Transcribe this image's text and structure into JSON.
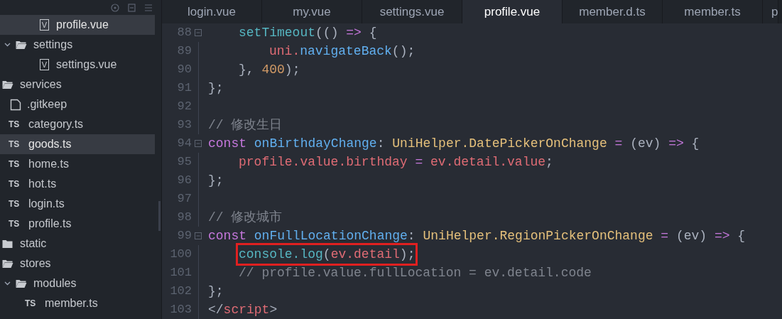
{
  "sidebar": {
    "tree": [
      {
        "kind": "offscreen",
        "children": [
          {
            "kind": "offscreen",
            "children": [
              {
                "kind": "file",
                "label": "profile.vue",
                "badge": "V",
                "selected": true
              }
            ]
          },
          {
            "kind": "folder",
            "label": "settings",
            "expanded": true,
            "selected": false,
            "children": [
              {
                "kind": "file",
                "label": "settings.vue",
                "badge": "V",
                "selected": false
              }
            ]
          }
        ]
      },
      {
        "kind": "folder",
        "label": "services",
        "expanded": true,
        "selected": false,
        "children": [
          {
            "kind": "file",
            "label": ".gitkeep",
            "selected": false
          },
          {
            "kind": "file",
            "label": "category.ts",
            "badge": "TS",
            "selected": false
          },
          {
            "kind": "file",
            "label": "goods.ts",
            "badge": "TS",
            "selected": true
          },
          {
            "kind": "file",
            "label": "home.ts",
            "badge": "TS",
            "selected": false
          },
          {
            "kind": "file",
            "label": "hot.ts",
            "badge": "TS",
            "selected": false
          },
          {
            "kind": "file",
            "label": "login.ts",
            "badge": "TS",
            "selected": false
          },
          {
            "kind": "file",
            "label": "profile.ts",
            "badge": "TS",
            "selected": false
          }
        ]
      },
      {
        "kind": "folder",
        "label": "static",
        "expanded": false,
        "selected": false
      },
      {
        "kind": "folder",
        "label": "stores",
        "expanded": true,
        "selected": false,
        "children": [
          {
            "kind": "folder",
            "label": "modules",
            "expanded": true,
            "selected": false,
            "children": [
              {
                "kind": "file",
                "label": "member.ts",
                "badge": "TS",
                "selected": false
              }
            ]
          }
        ]
      }
    ]
  },
  "tabs": [
    {
      "label": "login.vue",
      "selected": false
    },
    {
      "label": "my.vue",
      "selected": false
    },
    {
      "label": "settings.vue",
      "selected": false
    },
    {
      "label": "profile.vue",
      "selected": true
    },
    {
      "label": "member.d.ts",
      "selected": false
    },
    {
      "label": "member.ts",
      "selected": false
    },
    {
      "label": "p",
      "selected": false
    }
  ],
  "editor": {
    "lines": [
      {
        "kind": "offscreen",
        "children": [
          {
            "kind": "line",
            "number": "88",
            "foldable": true,
            "tokens": [
              {
                "kind": "func",
                "text": "setTimeout"
              },
              {
                "kind": "plain",
                "text": "(()"
              },
              {
                "kind": "keyword",
                "text": " =>"
              },
              {
                "kind": "plain",
                "text": " {"
              }
            ],
            "children": [
              {
                "kind": "line",
                "number": "89",
                "foldable": false,
                "tokens": [
                  {
                    "kind": "var",
                    "text": "uni."
                  },
                  {
                    "kind": "method",
                    "text": "navigateBack"
                  },
                  {
                    "kind": "plain",
                    "text": "();"
                  }
                ]
              }
            ]
          },
          {
            "kind": "line",
            "number": "90",
            "foldable": false,
            "tokens": [
              {
                "kind": "plain",
                "text": "},"
              },
              {
                "kind": "number",
                "text": " 400"
              },
              {
                "kind": "plain",
                "text": ");"
              }
            ]
          }
        ]
      },
      {
        "kind": "line",
        "number": "91",
        "foldable": false,
        "tokens": [
          {
            "kind": "plain",
            "text": "};"
          }
        ]
      },
      {
        "kind": "line",
        "number": "92",
        "foldable": false
      },
      {
        "kind": "line",
        "number": "93",
        "foldable": false,
        "tokens": [
          {
            "kind": "comment",
            "text": "// 修改生日"
          }
        ]
      },
      {
        "kind": "line",
        "number": "94",
        "foldable": true,
        "tokens": [
          {
            "kind": "keyword",
            "text": "const"
          },
          {
            "kind": "method",
            "text": " onBirthdayChange"
          },
          {
            "kind": "plain",
            "text": ":"
          },
          {
            "kind": "type",
            "text": " UniHelper.DatePickerOnChange"
          },
          {
            "kind": "keyword",
            "text": " ="
          },
          {
            "kind": "plain",
            "text": " (ev)"
          },
          {
            "kind": "keyword",
            "text": " =>"
          },
          {
            "kind": "plain",
            "text": " {"
          }
        ],
        "children": [
          {
            "kind": "line",
            "number": "95",
            "foldable": false,
            "tokens": [
              {
                "kind": "var",
                "text": "profile.value.birthday"
              },
              {
                "kind": "keyword",
                "text": " ="
              },
              {
                "kind": "var",
                "text": " ev.detail.value"
              },
              {
                "kind": "plain",
                "text": ";"
              }
            ]
          }
        ]
      },
      {
        "kind": "line",
        "number": "96",
        "foldable": false,
        "tokens": [
          {
            "kind": "plain",
            "text": "};"
          }
        ]
      },
      {
        "kind": "line",
        "number": "97",
        "foldable": false
      },
      {
        "kind": "line",
        "number": "98",
        "foldable": false,
        "tokens": [
          {
            "kind": "comment",
            "text": "// 修改城市"
          }
        ]
      },
      {
        "kind": "line",
        "number": "99",
        "foldable": true,
        "tokens": [
          {
            "kind": "keyword",
            "text": "const"
          },
          {
            "kind": "method",
            "text": " onFullLocationChange"
          },
          {
            "kind": "plain",
            "text": ":"
          },
          {
            "kind": "type",
            "text": " UniHelper.RegionPickerOnChange"
          },
          {
            "kind": "keyword",
            "text": " ="
          },
          {
            "kind": "plain",
            "text": " (ev)"
          },
          {
            "kind": "keyword",
            "text": " =>"
          },
          {
            "kind": "plain",
            "text": " {"
          }
        ],
        "children": [
          {
            "kind": "line",
            "number": "100",
            "foldable": false,
            "boxed": true,
            "tokens": [
              {
                "kind": "func",
                "text": "console.log"
              },
              {
                "kind": "plain",
                "text": "("
              },
              {
                "kind": "var",
                "text": "ev.detail"
              },
              {
                "kind": "plain",
                "text": ");"
              }
            ]
          },
          {
            "kind": "line",
            "number": "101",
            "foldable": false,
            "tokens": [
              {
                "kind": "comment",
                "text": "// profile.value.fullLocation = ev.detail.code"
              }
            ]
          }
        ]
      },
      {
        "kind": "line",
        "number": "102",
        "foldable": false,
        "tokens": [
          {
            "kind": "plain",
            "text": "};"
          }
        ]
      },
      {
        "kind": "line",
        "number": "103",
        "foldable": false,
        "tokens": [
          {
            "kind": "plain",
            "text": "</"
          },
          {
            "kind": "var",
            "text": "script"
          },
          {
            "kind": "plain",
            "text": ">"
          }
        ]
      }
    ]
  }
}
